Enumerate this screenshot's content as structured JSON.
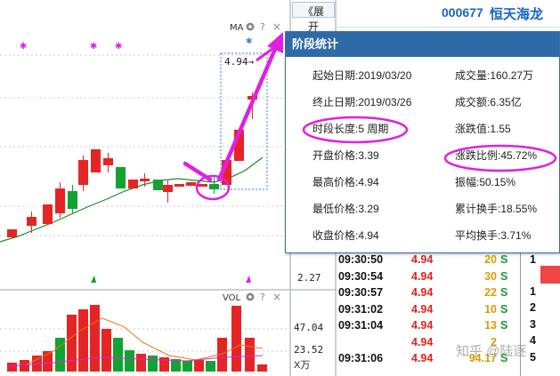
{
  "header": {
    "stock_code": "000677",
    "stock_name": "恒天海龙",
    "expand_button": "《展开"
  },
  "chart": {
    "ma_label": "MA",
    "vol_label": "VOL",
    "price_annotation": "4.94→",
    "price_axis_bottom": "2.27",
    "vol_axis": [
      "47.04",
      "23.52",
      "X万"
    ],
    "toolbar_icons": [
      "gear-icon",
      "help-icon",
      "close-icon"
    ]
  },
  "stats_panel": {
    "title": "阶段统计",
    "rows": [
      {
        "left": "起始日期:2019/03/20",
        "right": "成交量:160.27万"
      },
      {
        "left": "终止日期:2019/03/26",
        "right": "成交额:6.35亿"
      },
      {
        "left": "时段长度:5 周期",
        "right": "涨跌值:1.55"
      },
      {
        "left": "开盘价格:3.39",
        "right": "涨跌比例:45.72%"
      },
      {
        "left": "最高价格:4.94",
        "right": "振幅:50.15%"
      },
      {
        "left": "最低价格:3.29",
        "right": "累计换手:18.55%"
      },
      {
        "left": "收盘价格:4.94",
        "right": "平均换手:3.71%"
      }
    ]
  },
  "trades": [
    {
      "time": "09:30:50",
      "price": "4.94",
      "vol": "20",
      "side": "S"
    },
    {
      "time": "09:30:54",
      "price": "4.94",
      "vol": "30",
      "side": "S"
    },
    {
      "time": "09:30:57",
      "price": "4.94",
      "vol": "22",
      "side": "S"
    },
    {
      "time": "09:31:02",
      "price": "4.94",
      "vol": "10",
      "side": "S"
    },
    {
      "time": "09:31:04",
      "price": "4.94",
      "vol": "13",
      "side": "S"
    },
    {
      "time": "",
      "price": "4.94",
      "vol": "2",
      "side": ""
    },
    {
      "time": "09:31:06",
      "price": "4.94",
      "vol": "94.17",
      "side": "S"
    }
  ],
  "side_numbers": [
    "1",
    "1",
    "2",
    "3",
    "4",
    "5"
  ],
  "watermark": "知乎 @陆逐",
  "colors": {
    "up": "#e52525",
    "down": "#12a334",
    "ma": "#1b8c2a",
    "highlight": "#e020e0",
    "panel_title": "#2e6aa7"
  }
}
